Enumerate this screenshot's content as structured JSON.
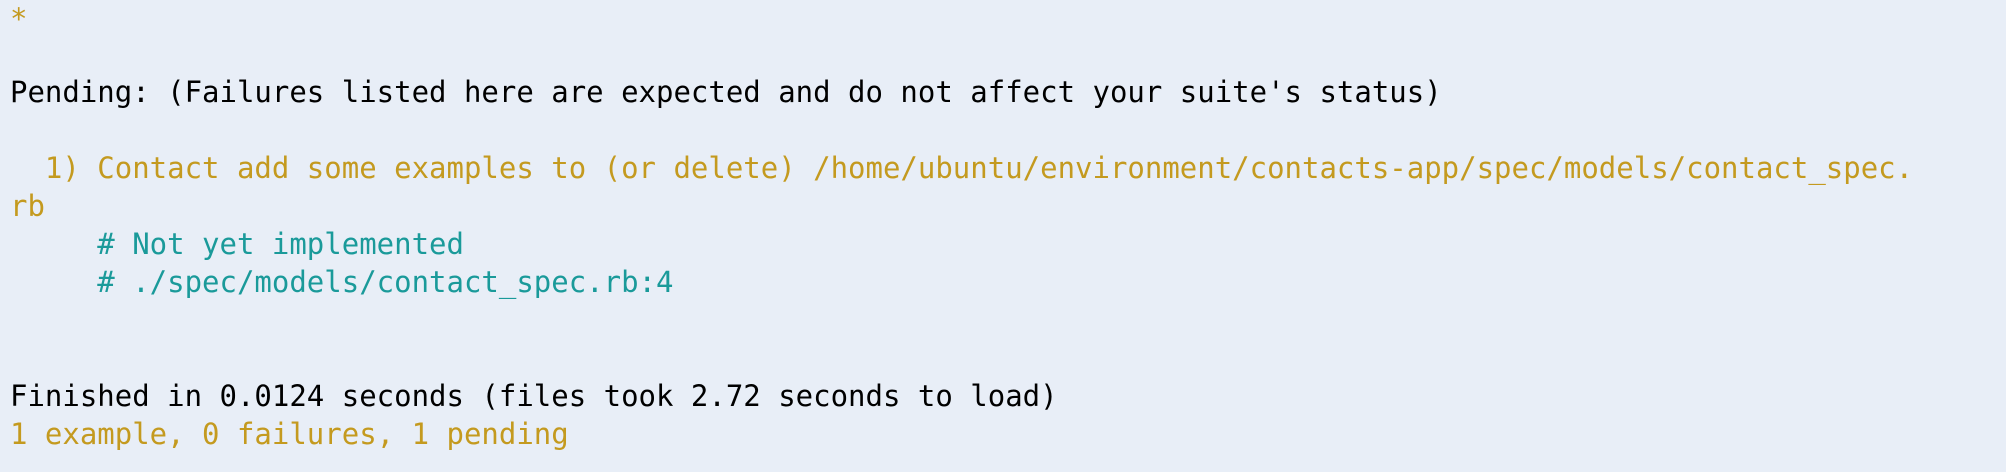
{
  "colors": {
    "background": "#e8eef7",
    "default_text": "#000000",
    "pending_yellow": "#c49a1f",
    "comment_cyan": "#1a9a9a"
  },
  "terminal": {
    "progress_marker": "*",
    "pending_header": "Pending: (Failures listed here are expected and do not affect your suite's status)",
    "pending_item_line1": "  1) Contact add some examples to (or delete) /home/ubuntu/environment/contacts-app/spec/models/contact_spec.",
    "pending_item_line2": "rb",
    "pending_reason": "     # Not yet implemented",
    "pending_location": "     # ./spec/models/contact_spec.rb:4",
    "finished_line": "Finished in 0.0124 seconds (files took 2.72 seconds to load)",
    "summary_line": "1 example, 0 failures, 1 pending"
  }
}
